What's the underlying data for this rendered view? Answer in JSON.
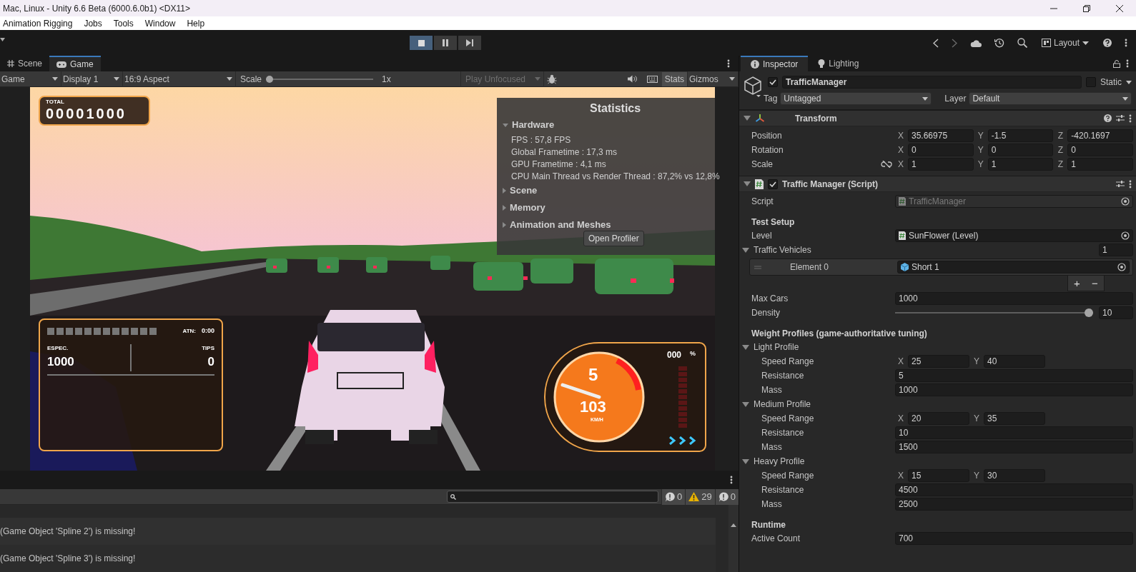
{
  "window": {
    "title": "Mac, Linux - Unity 6.6 Beta (6000.6.0b1) <DX11>"
  },
  "menu": [
    "Animation Rigging",
    "Jobs",
    "Tools",
    "Window",
    "Help"
  ],
  "toolbar": {
    "play_controls": [
      {
        "kind": "stop",
        "selected": true
      },
      {
        "kind": "pause",
        "selected": false
      },
      {
        "kind": "step",
        "selected": false
      }
    ],
    "layout": "Layout"
  },
  "view_tabs": [
    {
      "label": "Scene",
      "kind": "scene",
      "selected": false
    },
    {
      "label": "Game",
      "kind": "game",
      "selected": true
    }
  ],
  "game_toolbar": {
    "view": "Game",
    "display": "Display 1",
    "aspect": "16:9 Aspect",
    "scale_label": "Scale",
    "scale": {
      "level": 0
    },
    "scale_value": "1x",
    "play_mode": {
      "label": "Play Unfocused",
      "disabled": true
    },
    "stats": {
      "label": "Stats",
      "selected": true
    },
    "gizmos": "Gizmos"
  },
  "game_hud": {
    "total": {
      "label": "TOTAL",
      "value": "00001000"
    },
    "left_panel": {
      "atn_label": "ATN:",
      "atn_value": "0:00",
      "espec_label": "ESPEC.",
      "espec_value": "1000",
      "tips_label": "TIPS",
      "tips_value": "0"
    },
    "gauge": {
      "gear": "5",
      "speed": "103",
      "unit": "KM/H",
      "percent": "000",
      "percent_unit": "%"
    }
  },
  "statistics": {
    "title": "Statistics",
    "sections": [
      {
        "label": "Hardware",
        "expanded": true,
        "lines": [
          "FPS : 57,8 FPS",
          "Global Frametime : 17,3 ms",
          "GPU Frametime : 4,1 ms",
          "CPU Main Thread vs Render Thread : 87,2% vs 12,8%"
        ]
      },
      {
        "label": "Scene",
        "expanded": false
      },
      {
        "label": "Memory",
        "expanded": false
      },
      {
        "label": "Animation and Meshes",
        "expanded": false
      }
    ],
    "button": "Open Profiler"
  },
  "console": {
    "counts": [
      {
        "kind": "log",
        "count": "0"
      },
      {
        "kind": "warning",
        "count": "29"
      },
      {
        "kind": "error",
        "count": "0"
      }
    ],
    "messages": [
      "(Game Object 'Spline 2') is missing!",
      "(Game Object 'Spline 3') is missing!"
    ]
  },
  "inspector": {
    "tabs": [
      {
        "label": "Inspector",
        "kind": "info",
        "selected": true
      },
      {
        "label": "Lighting",
        "kind": "light",
        "selected": false
      }
    ],
    "object": {
      "enabled": true,
      "name": "TrafficManager",
      "static_label": "Static",
      "static": false,
      "tag_label": "Tag",
      "tag": "Untagged",
      "layer_label": "Layer",
      "layer": "Default"
    },
    "components": [
      {
        "title": "Transform",
        "kind": "transform",
        "expanded": true,
        "rows": [
          {
            "kind": "vector3",
            "label": "Position",
            "values": [
              {
                "axis": "X",
                "value": "35.66975"
              },
              {
                "axis": "Y",
                "value": "-1.5"
              },
              {
                "axis": "Z",
                "value": "-420.1697"
              }
            ]
          },
          {
            "kind": "vector3",
            "label": "Rotation",
            "values": [
              {
                "axis": "X",
                "value": "0"
              },
              {
                "axis": "Y",
                "value": "0"
              },
              {
                "axis": "Z",
                "value": "0"
              }
            ]
          },
          {
            "kind": "vector3",
            "label": "Scale",
            "constrained": false,
            "values": [
              {
                "axis": "X",
                "value": "1"
              },
              {
                "axis": "Y",
                "value": "1"
              },
              {
                "axis": "Z",
                "value": "1"
              }
            ]
          }
        ]
      },
      {
        "title": "Traffic Manager (Script)",
        "kind": "script",
        "enabled": true,
        "expanded": true,
        "rows": [
          {
            "kind": "object",
            "label": "Script",
            "value": "TrafficManager",
            "disabled": true
          },
          {
            "kind": "header",
            "label": "Test Setup"
          },
          {
            "kind": "object",
            "label": "Level",
            "value": "SunFlower (Level)",
            "disabled": false
          },
          {
            "kind": "list",
            "label": "Traffic Vehicles",
            "expanded": true,
            "count": "1",
            "buttons": [
              "+",
              "−"
            ],
            "children": [
              {
                "kind": "element",
                "label": "Element 0",
                "value": "Short 1"
              }
            ]
          },
          {
            "kind": "number",
            "label": "Max Cars",
            "value": "1000"
          },
          {
            "kind": "slider",
            "label": "Density",
            "level": 1,
            "value": "10"
          },
          {
            "kind": "header",
            "label": "Weight Profiles (game-authoritative tuning)"
          },
          {
            "kind": "foldout",
            "label": "Light Profile",
            "expanded": true,
            "children": [
              {
                "kind": "vector2",
                "label": "Speed Range",
                "values": [
                  {
                    "axis": "X",
                    "value": "25"
                  },
                  {
                    "axis": "Y",
                    "value": "40"
                  }
                ]
              },
              {
                "kind": "number",
                "label": "Resistance",
                "value": "5"
              },
              {
                "kind": "number",
                "label": "Mass",
                "value": "1000"
              }
            ]
          },
          {
            "kind": "foldout",
            "label": "Medium Profile",
            "expanded": true,
            "children": [
              {
                "kind": "vector2",
                "label": "Speed Range",
                "values": [
                  {
                    "axis": "X",
                    "value": "20"
                  },
                  {
                    "axis": "Y",
                    "value": "35"
                  }
                ]
              },
              {
                "kind": "number",
                "label": "Resistance",
                "value": "10"
              },
              {
                "kind": "number",
                "label": "Mass",
                "value": "1500"
              }
            ]
          },
          {
            "kind": "foldout",
            "label": "Heavy Profile",
            "expanded": true,
            "children": [
              {
                "kind": "vector2",
                "label": "Speed Range",
                "values": [
                  {
                    "axis": "X",
                    "value": "15"
                  },
                  {
                    "axis": "Y",
                    "value": "30"
                  }
                ]
              },
              {
                "kind": "number",
                "label": "Resistance",
                "value": "4500"
              },
              {
                "kind": "number",
                "label": "Mass",
                "value": "2500"
              }
            ]
          },
          {
            "kind": "header",
            "label": "Runtime"
          },
          {
            "kind": "number",
            "label": "Active Count",
            "value": "700"
          }
        ]
      }
    ]
  }
}
